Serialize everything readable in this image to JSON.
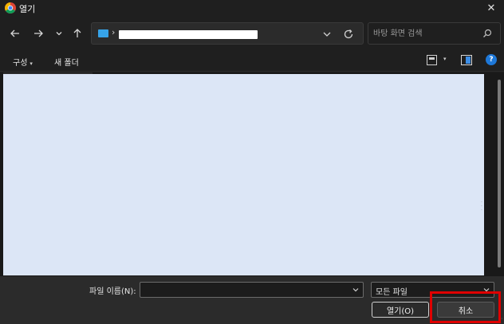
{
  "window": {
    "title": "열기",
    "close_glyph": "✕",
    "app_icon": "chrome-icon"
  },
  "nav": {
    "back_icon": "arrow-left-icon",
    "forward_icon": "arrow-right-icon",
    "recent_icon": "chevron-down-icon",
    "up_icon": "arrow-up-icon",
    "address_separator": "›",
    "refresh_icon": "refresh-icon"
  },
  "search": {
    "placeholder": "바탕 화면 검색"
  },
  "toolbar": {
    "organize_label": "구성",
    "organize_caret": "▾",
    "new_folder_label": "새 폴더",
    "view_caret": "▾",
    "help_label": "?"
  },
  "bottom": {
    "filename_label": "파일 이름(N):",
    "filename_value": "",
    "filetype_value": "모든 파일",
    "open_label": "열기(O)",
    "cancel_label": "취소"
  },
  "colors": {
    "accent": "#1e78d8",
    "highlight": "#e00000",
    "file_pane": "#dce6f6"
  }
}
